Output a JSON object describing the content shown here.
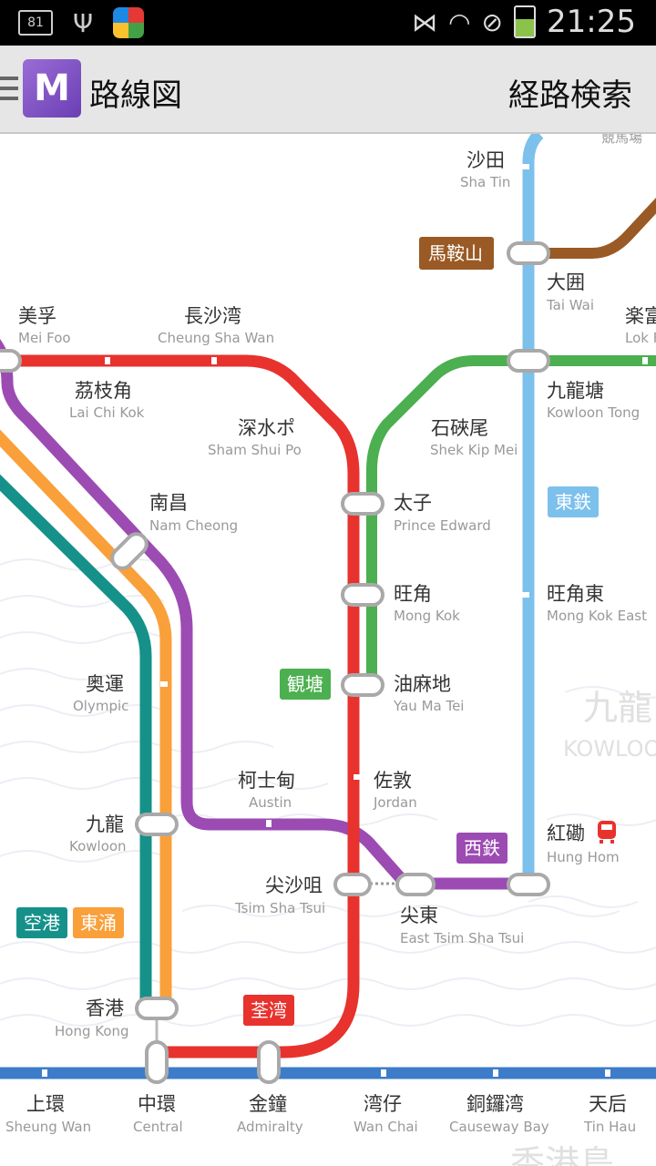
{
  "status_bar": {
    "notification_count": "81",
    "time": "21:25",
    "icons": [
      "usb-icon",
      "app-icon",
      "muted-signal-icon",
      "wifi-icon",
      "blocked-icon",
      "battery-charging-icon"
    ]
  },
  "toolbar": {
    "title": "路線図",
    "route_search_label": "経路検索",
    "logo_letter": "M"
  },
  "map": {
    "line_colors": {
      "tsuen_wan": "#e8322e",
      "kwun_tong": "#4caf50",
      "east_rail": "#7cc0ec",
      "west_rail": "#9c4bb3",
      "tung_chung": "#f9a03a",
      "airport_express": "#16918a",
      "ma_on_shan": "#9a5a25",
      "island": "#3d7cc9"
    },
    "badges": {
      "ma_on_shan": "馬鞍山",
      "east_rail": "東鉄",
      "kwun_tong": "観塘",
      "west_rail": "西鉄",
      "airport_express": "空港",
      "tung_chung": "東涌",
      "tsuen_wan": "荃湾"
    },
    "area": {
      "name": "九龍",
      "name_en": "KOWLOON",
      "bottom_text": "香港島",
      "top_right_text": "競馬場"
    },
    "stations": {
      "sha_tin": {
        "zh": "沙田",
        "en": "Sha Tin"
      },
      "tai_wai": {
        "zh": "大囲",
        "en": "Tai Wai"
      },
      "lok_fu": {
        "zh": "楽富",
        "en": "Lok Fu"
      },
      "mei_foo": {
        "zh": "美孚",
        "en": "Mei Foo"
      },
      "cheung_sha_wan": {
        "zh": "長沙湾",
        "en": "Cheung Sha Wan"
      },
      "lai_chi_kok": {
        "zh": "茘枝角",
        "en": "Lai Chi Kok"
      },
      "sham_shui_po": {
        "zh": "深水ポ",
        "en": "Sham Shui Po"
      },
      "shek_kip_mei": {
        "zh": "石硤尾",
        "en": "Shek Kip Mei"
      },
      "kowloon_tong": {
        "zh": "九龍塘",
        "en": "Kowloon Tong"
      },
      "nam_cheong": {
        "zh": "南昌",
        "en": "Nam Cheong"
      },
      "prince_edward": {
        "zh": "太子",
        "en": "Prince Edward"
      },
      "mong_kok": {
        "zh": "旺角",
        "en": "Mong Kok"
      },
      "mong_kok_east": {
        "zh": "旺角東",
        "en": "Mong Kok East"
      },
      "olympic": {
        "zh": "奥運",
        "en": "Olympic"
      },
      "yau_ma_tei": {
        "zh": "油麻地",
        "en": "Yau Ma Tei"
      },
      "austin": {
        "zh": "柯士甸",
        "en": "Austin"
      },
      "jordan": {
        "zh": "佐敦",
        "en": "Jordan"
      },
      "kowloon": {
        "zh": "九龍",
        "en": "Kowloon"
      },
      "hung_hom": {
        "zh": "紅磡",
        "en": "Hung Hom"
      },
      "tsim_sha_tsui": {
        "zh": "尖沙咀",
        "en": "Tsim Sha Tsui"
      },
      "east_tsim_sha_tsui": {
        "zh": "尖東",
        "en": "East Tsim Sha Tsui"
      },
      "hong_kong": {
        "zh": "香港",
        "en": "Hong Kong"
      },
      "sheung_wan": {
        "zh": "上環",
        "en": "Sheung Wan"
      },
      "central": {
        "zh": "中環",
        "en": "Central"
      },
      "admiralty": {
        "zh": "金鐘",
        "en": "Admiralty"
      },
      "wan_chai": {
        "zh": "湾仔",
        "en": "Wan Chai"
      },
      "causeway_bay": {
        "zh": "銅鑼湾",
        "en": "Causeway Bay"
      },
      "tin_hau": {
        "zh": "天后",
        "en": "Tin Hau"
      }
    }
  }
}
